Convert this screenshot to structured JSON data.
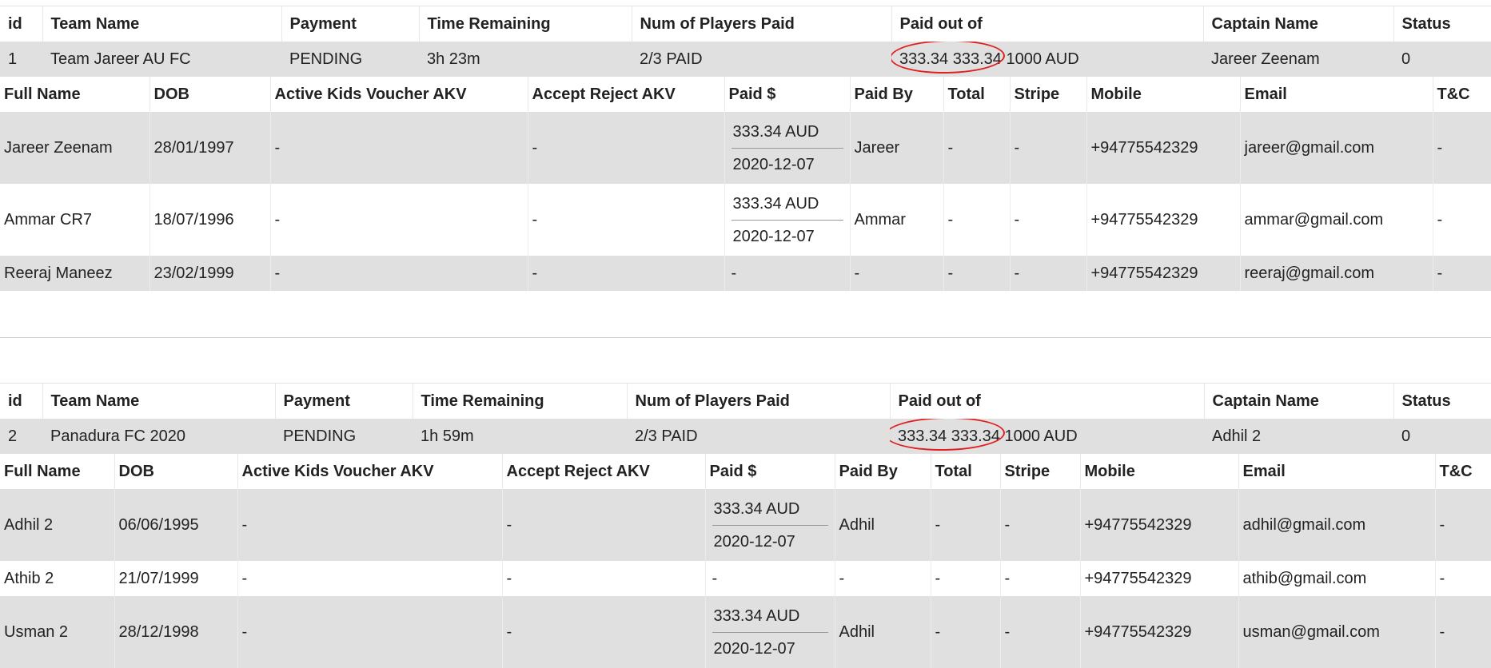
{
  "team_headers": [
    "id",
    "Team Name",
    "Payment",
    "Time Remaining",
    "Num of Players Paid",
    "Paid out of",
    "Captain Name",
    "Status"
  ],
  "player_headers": [
    "Full Name",
    "DOB",
    "Active Kids Voucher AKV",
    "Accept Reject AKV",
    "Paid $",
    "Paid By",
    "Total",
    "Stripe",
    "Mobile",
    "Email",
    "T&C"
  ],
  "teams": [
    {
      "id": "1",
      "name": "Team Jareer AU FC",
      "payment": "PENDING",
      "time_remaining": "3h 23m",
      "players_paid": "2/3 PAID",
      "paid_amounts": "333.34 333.34",
      "paid_total": "1000 AUD",
      "captain": "Jareer Zeenam",
      "status": "0",
      "players": [
        {
          "name": "Jareer Zeenam",
          "dob": "28/01/1997",
          "akv": "-",
          "accept": "-",
          "paid_amt": "333.34 AUD",
          "paid_date": "2020-12-07",
          "paid_by": "Jareer",
          "total": "-",
          "stripe": "-",
          "mobile": "+94775542329",
          "email": "jareer@gmail.com",
          "tc": "-"
        },
        {
          "name": "Ammar CR7",
          "dob": "18/07/1996",
          "akv": "-",
          "accept": "-",
          "paid_amt": "333.34 AUD",
          "paid_date": "2020-12-07",
          "paid_by": "Ammar",
          "total": "-",
          "stripe": "-",
          "mobile": "+94775542329",
          "email": "ammar@gmail.com",
          "tc": "-"
        },
        {
          "name": "Reeraj Maneez",
          "dob": "23/02/1999",
          "akv": "-",
          "accept": "-",
          "paid_amt": "-",
          "paid_date": "",
          "paid_by": "-",
          "total": "-",
          "stripe": "-",
          "mobile": "+94775542329",
          "email": "reeraj@gmail.com",
          "tc": "-"
        }
      ]
    },
    {
      "id": "2",
      "name": "Panadura FC 2020",
      "payment": "PENDING",
      "time_remaining": "1h 59m",
      "players_paid": "2/3 PAID",
      "paid_amounts": "333.34 333.34",
      "paid_total": "1000 AUD",
      "captain": "Adhil 2",
      "status": "0",
      "players": [
        {
          "name": "Adhil 2",
          "dob": "06/06/1995",
          "akv": "-",
          "accept": "-",
          "paid_amt": "333.34 AUD",
          "paid_date": "2020-12-07",
          "paid_by": "Adhil",
          "total": "-",
          "stripe": "-",
          "mobile": "+94775542329",
          "email": "adhil@gmail.com",
          "tc": "-"
        },
        {
          "name": "Athib 2",
          "dob": "21/07/1999",
          "akv": "-",
          "accept": "-",
          "paid_amt": "-",
          "paid_date": "",
          "paid_by": "-",
          "total": "-",
          "stripe": "-",
          "mobile": "+94775542329",
          "email": "athib@gmail.com",
          "tc": "-"
        },
        {
          "name": "Usman 2",
          "dob": "28/12/1998",
          "akv": "-",
          "accept": "-",
          "paid_amt": "333.34 AUD",
          "paid_date": "2020-12-07",
          "paid_by": "Adhil",
          "total": "-",
          "stripe": "-",
          "mobile": "+94775542329",
          "email": "usman@gmail.com",
          "tc": "-"
        }
      ]
    }
  ],
  "colors": {
    "row_shade": "#e0e0e0",
    "annotation": "#e02020"
  }
}
